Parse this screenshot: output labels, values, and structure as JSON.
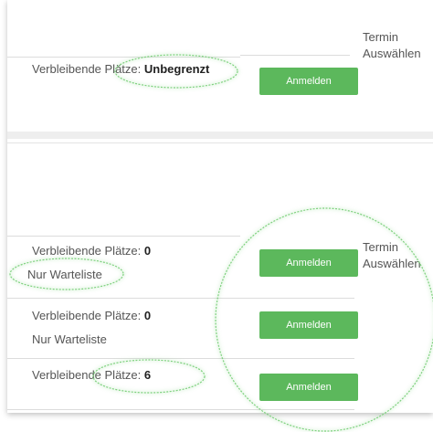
{
  "colors": {
    "button": "#5cb85c",
    "highlight": "#7ed17e"
  },
  "sections": [
    {
      "termin_label": "Termin Auswählen",
      "rows": [
        {
          "places_label": "Verbleibende Plätze:",
          "places_value": "Unbegrenzt",
          "note": "",
          "button_label": "Anmelden"
        }
      ]
    },
    {
      "termin_label": "Termin Auswählen",
      "rows": [
        {
          "places_label": "Verbleibende Plätze:",
          "places_value": "0",
          "note": "Nur Warteliste",
          "button_label": "Anmelden"
        },
        {
          "places_label": "Verbleibende Plätze:",
          "places_value": "0",
          "note": "Nur Warteliste",
          "button_label": "Anmelden"
        },
        {
          "places_label": "Verbleibende Plätze:",
          "places_value": "6",
          "note": "",
          "button_label": "Anmelden"
        }
      ]
    }
  ]
}
